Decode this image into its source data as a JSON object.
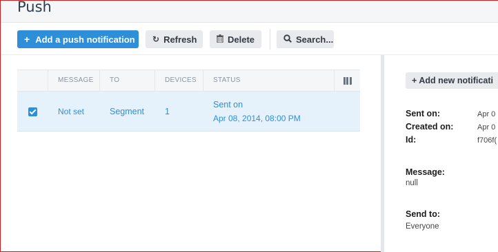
{
  "header": {
    "title": "Push"
  },
  "toolbar": {
    "add_label": "Add a push notification",
    "refresh_label": "Refresh",
    "delete_label": "Delete",
    "search_label": "Search..."
  },
  "table": {
    "columns": [
      "MESSAGE",
      "TO",
      "DEVICES",
      "STATUS"
    ],
    "rows": [
      {
        "checked": true,
        "message": "Not set",
        "to": "Segment",
        "devices": "1",
        "status": "Sent on",
        "status_date": "Apr 08, 2014, 08:00 PM"
      }
    ]
  },
  "detail": {
    "add_new_label": "Add new notificati",
    "sent_on_label": "Sent on:",
    "sent_on_value": "Apr 0",
    "created_on_label": "Created on:",
    "created_on_value": "Apr 0",
    "id_label": "Id:",
    "id_value": "f706f(",
    "message_label": "Message:",
    "message_value": "null",
    "send_to_label": "Send to:",
    "send_to_value": "Everyone"
  },
  "colors": {
    "accent": "#2e8fd8",
    "selected_row": "#e6f2fb",
    "frame_border": "#c81e1e"
  }
}
